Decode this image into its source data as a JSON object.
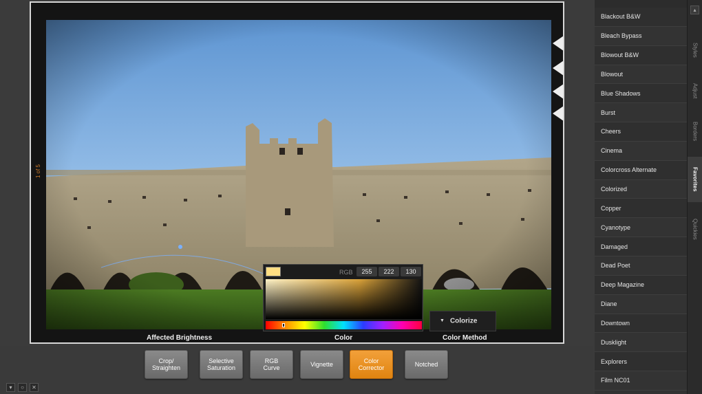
{
  "editor": {
    "color_picker": {
      "rgb_label": "RGB",
      "r": "255",
      "g": "222",
      "b": "130",
      "swatch_color": "#ffde82"
    },
    "color_method_value": "Colorize",
    "labels": {
      "affected_brightness": "Affected Brightness",
      "color": "Color",
      "color_method": "Color Method"
    },
    "edge_marker": "1 of 5"
  },
  "toolbar": {
    "buttons": [
      {
        "label": "Crop/\nStraighten",
        "active": false
      },
      {
        "label": "Selective\nSaturation",
        "active": false
      },
      {
        "label": "RGB\nCurve",
        "active": false
      },
      {
        "label": "Vignette",
        "active": false
      },
      {
        "label": "Color\nCorrector",
        "active": true
      },
      {
        "label": "Notched",
        "active": false
      }
    ],
    "accent_color": "#e88a18"
  },
  "styles": {
    "items": [
      "Blackout B&W",
      "Bleach Bypass",
      "Blowout B&W",
      "Blowout",
      "Blue Shadows",
      "Burst",
      "Cheers",
      "Cinema",
      "Colorcross Alternate",
      "Colorized",
      "Copper",
      "Cyanotype",
      "Damaged",
      "Dead Poet",
      "Deep Magazine",
      "Diane",
      "Downtown",
      "Dusklight",
      "Explorers",
      "Film NC01"
    ]
  },
  "tabs": [
    {
      "label": "Styles",
      "active": false
    },
    {
      "label": "Adjust",
      "active": false
    },
    {
      "label": "Borders",
      "active": false
    },
    {
      "label": "Favorites",
      "active": true
    },
    {
      "label": "Quickies",
      "active": false
    }
  ],
  "icons": {
    "scroll_up": "chevron-up-icon",
    "mini": [
      "dropdown-icon",
      "settings-icon",
      "close-icon"
    ]
  }
}
